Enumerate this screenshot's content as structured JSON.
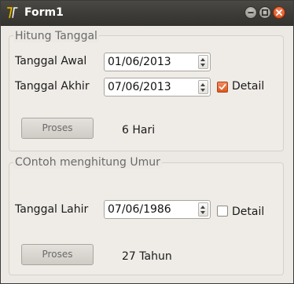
{
  "window": {
    "title": "Form1"
  },
  "date_calc": {
    "group_title": "Hitung Tanggal",
    "start_label": "Tanggal Awal",
    "start_value": "01/06/2013",
    "end_label": "Tanggal Akhir",
    "end_value": "07/06/2013",
    "detail_label": "Detail",
    "detail_checked": true,
    "process_label": "Proses",
    "result": "6 Hari"
  },
  "age_calc": {
    "group_title": "COntoh menghitung Umur",
    "birth_label": "Tanggal Lahir",
    "birth_value": "07/06/1986",
    "detail_label": "Detail",
    "detail_checked": false,
    "process_label": "Proses",
    "result": "27 Tahun"
  },
  "colors": {
    "titlebar": "#3b3a36",
    "close_button": "#e0581f",
    "checkbox_checked": "#e0581f",
    "window_bg": "#ece9e4"
  },
  "icons": {
    "app": "app-icon",
    "minimize": "minimize-icon",
    "maximize": "maximize-icon",
    "close": "close-icon",
    "spin_up": "spin-up-icon",
    "spin_down": "spin-down-icon",
    "check": "checkmark-icon"
  }
}
